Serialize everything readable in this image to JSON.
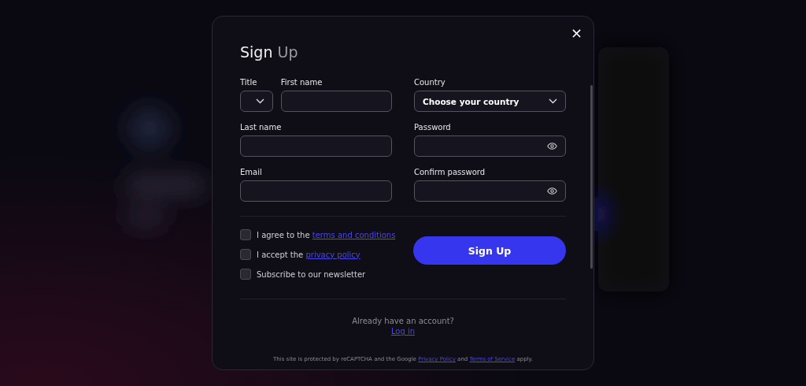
{
  "dialog": {
    "title": {
      "primary": "Sign",
      "secondary": "Up"
    },
    "close_label": "×"
  },
  "fields_left": [
    {
      "parts": [
        {
          "kind": "select",
          "label": "Title"
        },
        {
          "kind": "text",
          "label": "First name"
        }
      ]
    },
    {
      "parts": [
        {
          "kind": "text",
          "label": "Last name"
        }
      ]
    },
    {
      "parts": [
        {
          "kind": "text",
          "label": "Email"
        }
      ]
    }
  ],
  "fields_right": [
    {
      "kind": "select",
      "label": "Country",
      "value": "Choose your country"
    },
    {
      "kind": "password",
      "label": "Password"
    },
    {
      "kind": "password",
      "label": "Confirm password"
    }
  ],
  "checkboxes": [
    {
      "text": "I agree to the ",
      "link": "terms and conditions",
      "checked": false
    },
    {
      "text": "I accept the ",
      "link": "privacy policy",
      "checked": false
    },
    {
      "text": "Subscribe to our newsletter",
      "checked": false
    }
  ],
  "submit": "Sign Up",
  "login": {
    "prompt": "Already have an account?",
    "link": "Log in"
  },
  "footer": {
    "parts": [
      {
        "kind": "text",
        "text": "This site is protected by reCAPTCHA and the Google "
      },
      {
        "kind": "link",
        "text": "Privacy Policy"
      },
      {
        "kind": "text",
        "text": " and "
      },
      {
        "kind": "link",
        "text": "Terms of Service"
      },
      {
        "kind": "text",
        "text": " apply."
      }
    ]
  }
}
